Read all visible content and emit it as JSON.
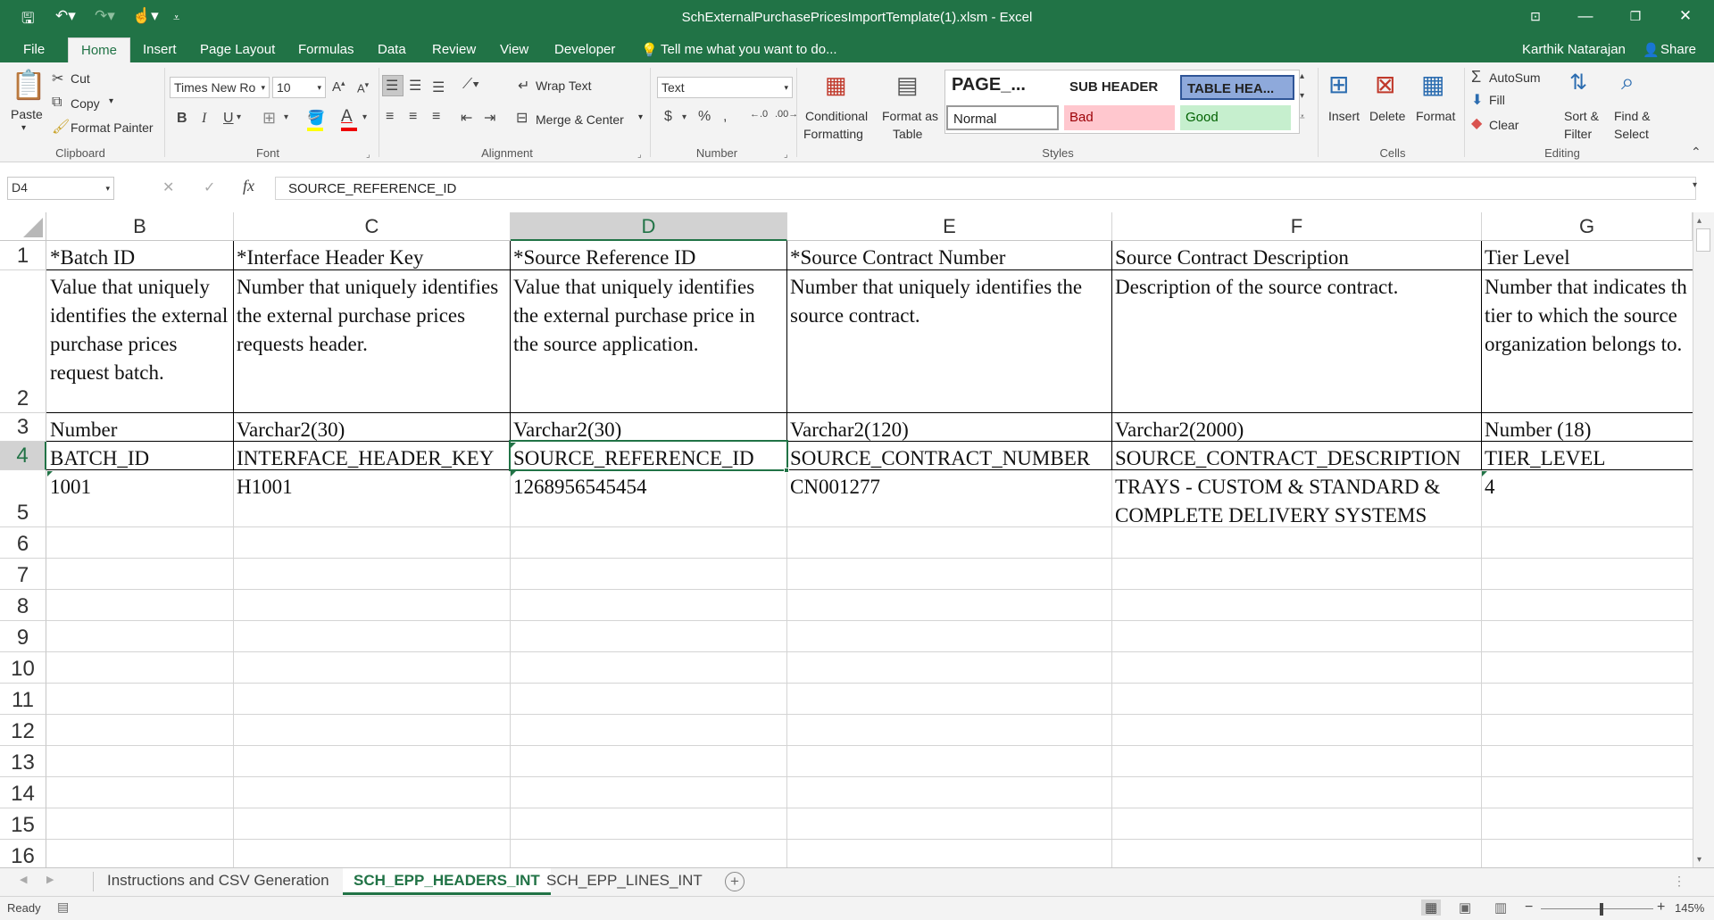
{
  "window": {
    "title": "SchExternalPurchasePricesImportTemplate(1).xlsm - Excel",
    "user": "Karthik Natarajan",
    "share": "Share"
  },
  "ribbon_tabs": [
    "File",
    "Home",
    "Insert",
    "Page Layout",
    "Formulas",
    "Data",
    "Review",
    "View",
    "Developer"
  ],
  "tell_me": "Tell me what you want to do...",
  "clipboard": {
    "paste": "Paste",
    "cut": "Cut",
    "copy": "Copy",
    "format_painter": "Format Painter",
    "label": "Clipboard"
  },
  "font": {
    "name": "Times New Ro",
    "size": "10",
    "label": "Font"
  },
  "alignment": {
    "wrap": "Wrap Text",
    "merge": "Merge & Center",
    "label": "Alignment"
  },
  "number": {
    "format": "Text",
    "label": "Number"
  },
  "styles": {
    "conditional": "Conditional",
    "conditional2": "Formatting",
    "format_as": "Format as",
    "format_as2": "Table",
    "page": "PAGE_...",
    "sub": "SUB HEADER",
    "tablehea": "TABLE HEA...",
    "normal": "Normal",
    "bad": "Bad",
    "good": "Good",
    "label": "Styles"
  },
  "cells": {
    "insert": "Insert",
    "delete": "Delete",
    "format": "Format",
    "label": "Cells"
  },
  "editing": {
    "autosum": "AutoSum",
    "fill": "Fill",
    "clear": "Clear",
    "sort": "Sort &",
    "sort2": "Filter",
    "find": "Find &",
    "find2": "Select",
    "label": "Editing"
  },
  "formula_bar": {
    "name_box": "D4",
    "formula": "SOURCE_REFERENCE_ID"
  },
  "columns": [
    "B",
    "C",
    "D",
    "E",
    "F",
    "G"
  ],
  "rows": [
    "1",
    "2",
    "3",
    "4",
    "5",
    "6",
    "7",
    "8",
    "9",
    "10",
    "11",
    "12",
    "13",
    "14",
    "15",
    "16"
  ],
  "cells_data": {
    "r1": [
      "*Batch ID",
      "*Interface Header Key",
      "*Source Reference ID",
      "*Source Contract Number",
      "Source Contract Description",
      "Tier Level"
    ],
    "r2": [
      "Value that uniquely identifies the external purchase prices request batch.",
      "Number that uniquely identifies the external purchase prices requests header.",
      "Value that uniquely identifies the external purchase price in the source application.",
      "Number that uniquely identifies the source contract.",
      "Description of the source contract.",
      "Number that indicates th tier to which the source organization belongs to."
    ],
    "r3": [
      "Number",
      "Varchar2(30)",
      "Varchar2(30)",
      "Varchar2(120)",
      "Varchar2(2000)",
      "Number (18)"
    ],
    "r4": [
      "BATCH_ID",
      "INTERFACE_HEADER_KEY",
      "SOURCE_REFERENCE_ID",
      "SOURCE_CONTRACT_NUMBER",
      "SOURCE_CONTRACT_DESCRIPTION",
      "TIER_LEVEL"
    ],
    "r5": [
      "1001",
      "H1001",
      "1268956545454",
      "CN001277",
      "TRAYS - CUSTOM & STANDARD & COMPLETE DELIVERY SYSTEMS",
      "4"
    ]
  },
  "sheet_tabs": [
    "Instructions and CSV Generation",
    "SCH_EPP_HEADERS_INT",
    "SCH_EPP_LINES_INT"
  ],
  "status": {
    "ready": "Ready",
    "zoom": "145%"
  },
  "colors": {
    "excel_green": "#217346",
    "bad_bg": "#ffc7ce",
    "good_bg": "#c6efce",
    "tablehead_bg": "#8ea9db"
  }
}
